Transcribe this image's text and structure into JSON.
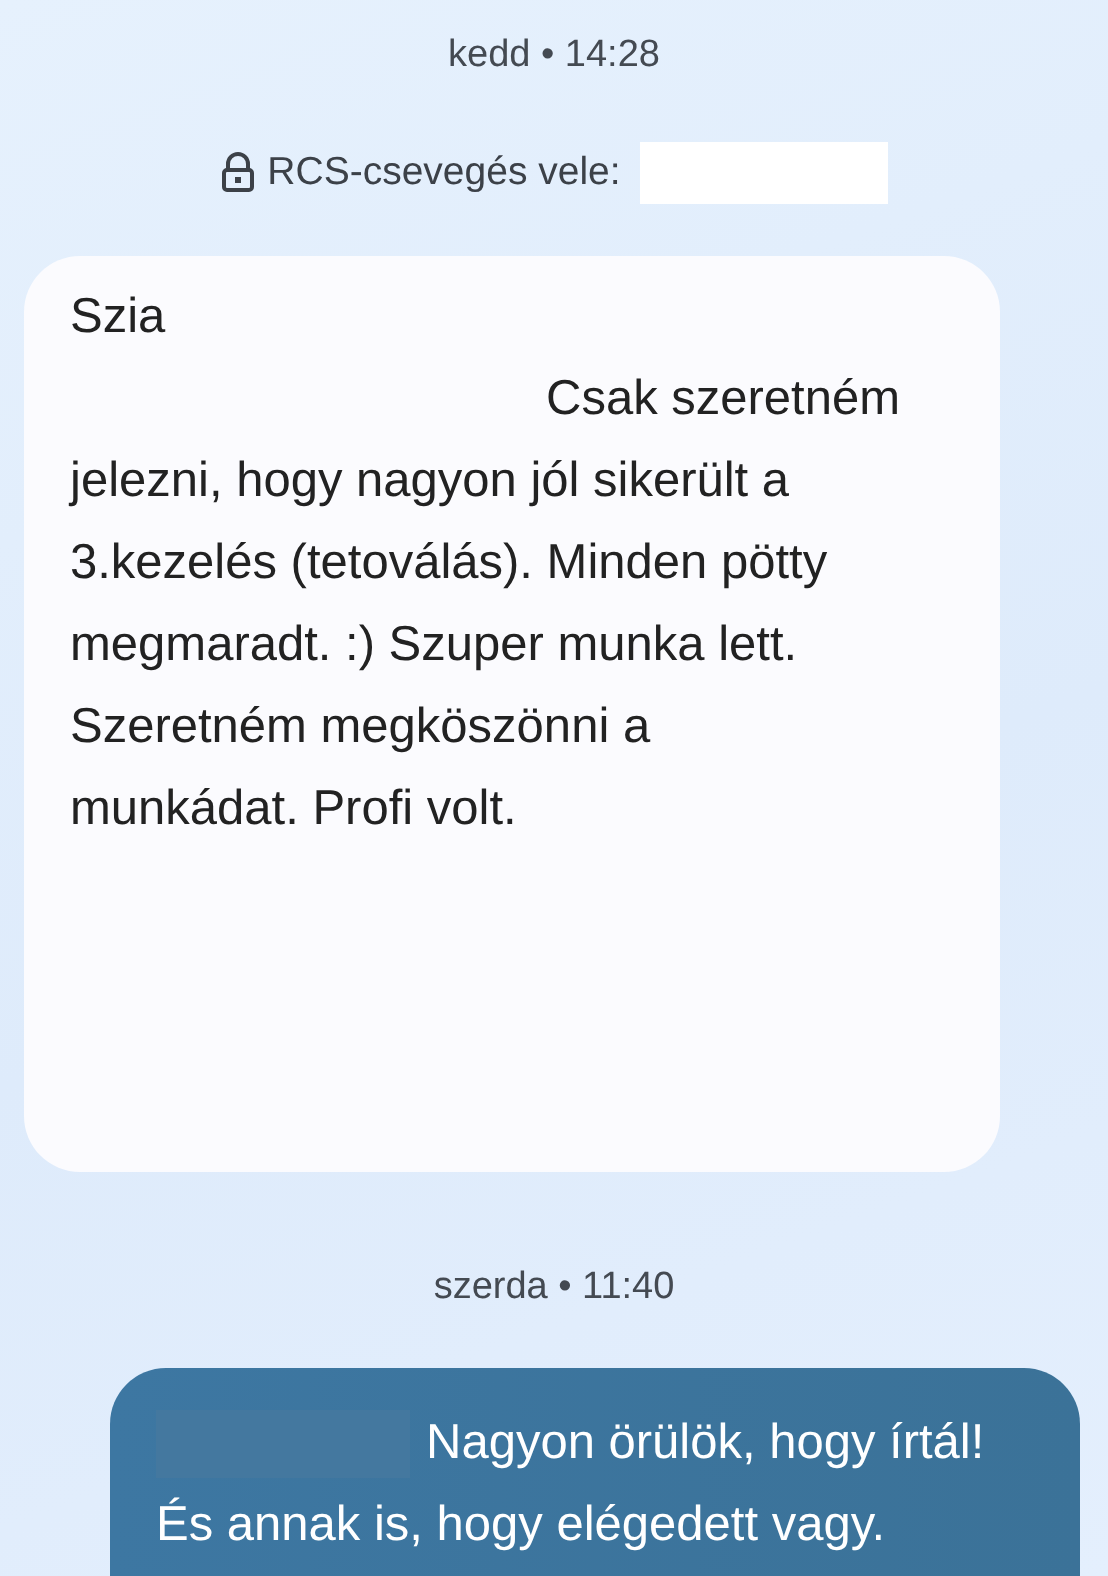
{
  "conversation": [
    {
      "kind": "timestamp",
      "text": "kedd • 14:28"
    },
    {
      "kind": "notice",
      "text": "RCS-csevegés vele:",
      "redacted": true
    },
    {
      "kind": "received",
      "lines": [
        [
          {
            "kind": "text",
            "text": "Szia"
          }
        ],
        [
          {
            "kind": "redacted"
          },
          {
            "kind": "text",
            "text": "Csak szeretném"
          }
        ],
        [
          {
            "kind": "text",
            "text": "jelezni, hogy nagyon jól sikerült a"
          }
        ],
        [
          {
            "kind": "text",
            "text": "3.kezelés (tetoválás). Minden pötty"
          }
        ],
        [
          {
            "kind": "text",
            "text": "megmaradt. :)  Szuper munka lett."
          }
        ],
        [
          {
            "kind": "text",
            "text": "Szeretném megköszönni a"
          }
        ],
        [
          {
            "kind": "text",
            "text": "munkádat. Profi volt."
          },
          {
            "kind": "redacted"
          }
        ],
        [
          {
            "kind": "redacted"
          }
        ]
      ]
    },
    {
      "kind": "timestamp",
      "text": "szerda • 11:40"
    },
    {
      "kind": "sent",
      "lines": [
        [
          {
            "kind": "redacted"
          },
          {
            "kind": "text",
            "text": "Nagyon örülök, hogy írtál!"
          }
        ],
        [
          {
            "kind": "text",
            "text": "És annak is, hogy elégedett vagy."
          }
        ]
      ]
    }
  ]
}
